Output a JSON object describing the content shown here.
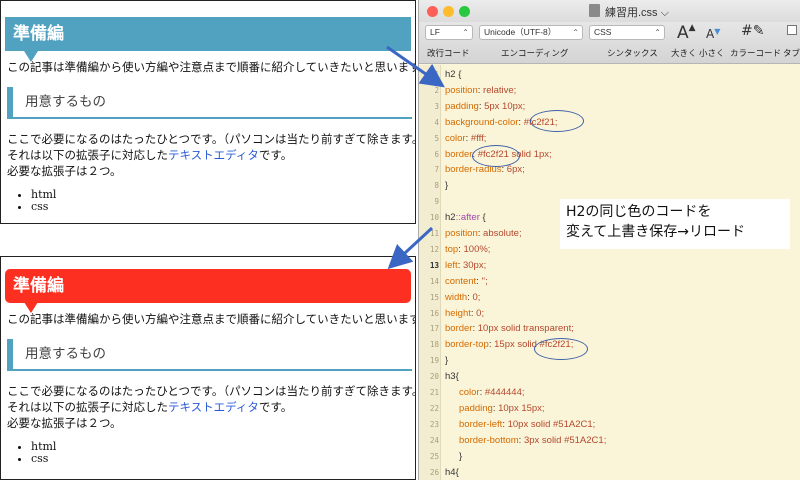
{
  "preview_top": {
    "h2_heading": "準備編",
    "intro": "この記事は準備編から使い方編や注意点まで順番に紹介していきたいと思います。",
    "h3_heading": "用意するもの",
    "line1": "ここで必要になるのはたったひとつです。（パソコンは当たり前すぎて除きます。）",
    "line2_before": "それは以下の拡張子に対応した",
    "line2_link": "テキストエディタ",
    "line2_after": "です。",
    "line3": "必要な拡張子は２つ。",
    "bullets": [
      "html",
      "css"
    ]
  },
  "preview_bottom": {
    "h2_heading": "準備編",
    "intro": "この記事は準備編から使い方編や注意点まで順番に紹介していきたいと思います。",
    "h3_heading": "用意するもの",
    "line1": "ここで必要になるのはたったひとつです。（パソコンは当たり前すぎて除きます。）",
    "line2_before": "それは以下の拡張子に対応した",
    "line2_link": "テキストエディタ",
    "line2_after": "です。",
    "line3": "必要な拡張子は２つ。",
    "bullets": [
      "html",
      "css"
    ]
  },
  "editor": {
    "title": "練習用.css",
    "title_chevron": "⌵",
    "toolbar": {
      "line_ending": "LF",
      "line_ending_label": "改行コード",
      "encoding": "Unicode（UTF-8）",
      "encoding_label": "エンコーディング",
      "syntax": "CSS",
      "syntax_label": "シンタックス",
      "bigger_label": "大きく",
      "smaller_label": "小さく",
      "color_code_label": "カラーコード",
      "tab_label": "タブ"
    },
    "lines": [
      {
        "n": "1",
        "sel": "h2 {"
      },
      {
        "n": "2",
        "prop": "position",
        "val": "relative;"
      },
      {
        "n": "3",
        "prop": "padding",
        "val": "5px 10px;"
      },
      {
        "n": "4",
        "prop": "background-color",
        "val": "#fc2f21;"
      },
      {
        "n": "5",
        "prop": "color",
        "val": "#fff;"
      },
      {
        "n": "6",
        "prop": "border",
        "val": "#fc2f21 solid 1px;"
      },
      {
        "n": "7",
        "prop": "border-radius",
        "val": "6px;"
      },
      {
        "n": "8",
        "sel": "}"
      },
      {
        "n": "9",
        "sel": ""
      },
      {
        "n": "10",
        "sel": "h2",
        "pseudo": "::after",
        "sel2": " {"
      },
      {
        "n": "11",
        "prop": "position",
        "val": "absolute;"
      },
      {
        "n": "12",
        "prop": "top",
        "val": "100%;"
      },
      {
        "n": "13",
        "prop": "left",
        "val": "30px;"
      },
      {
        "n": "14",
        "prop": "content",
        "val": "'';"
      },
      {
        "n": "15",
        "prop": "width",
        "val": "0;"
      },
      {
        "n": "16",
        "prop": "height",
        "val": "0;"
      },
      {
        "n": "17",
        "prop": "border",
        "val": "10px solid transparent;"
      },
      {
        "n": "18",
        "prop": "border-top",
        "val": "15px solid #fc2f21;"
      },
      {
        "n": "19",
        "sel": "}"
      },
      {
        "n": "20",
        "sel": "h3{"
      },
      {
        "n": "21",
        "prop": "color",
        "val": "#444444;"
      },
      {
        "n": "22",
        "prop": "padding",
        "val": "10px 15px;"
      },
      {
        "n": "23",
        "prop": "border-left",
        "val": "10px solid #51A2C1;"
      },
      {
        "n": "24",
        "prop": "border-bottom",
        "val": "3px solid #51A2C1;"
      },
      {
        "n": "25",
        "sel": "}"
      },
      {
        "n": "26",
        "sel": "h4{"
      }
    ]
  },
  "annotation": {
    "line1": "H2の同じ色のコードを",
    "line2": "変えて上書き保存→リロード"
  },
  "colors": {
    "original_h2": "#51a2c1",
    "new_h2": "#fc2f21",
    "arrow": "#3b67c4"
  }
}
